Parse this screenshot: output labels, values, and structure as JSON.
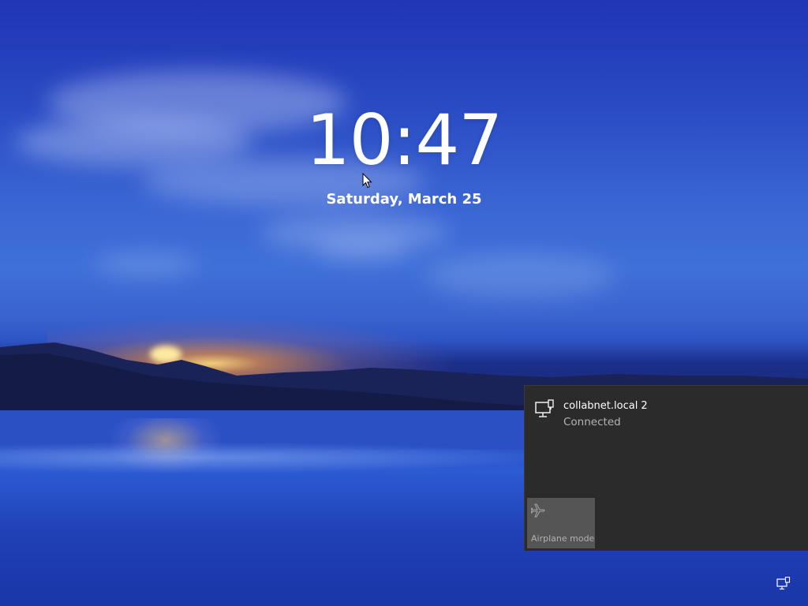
{
  "lock_screen": {
    "time": "10:47",
    "date": "Saturday, March 25"
  },
  "network_flyout": {
    "network_name": "collabnet.local 2",
    "network_status": "Connected",
    "network_icon": "wired-network-icon",
    "airplane_mode": {
      "label": "Airplane mode",
      "icon": "airplane-icon",
      "enabled": false
    }
  },
  "tray": {
    "network_icon": "network-icon"
  },
  "colors": {
    "flyout_bg": "#2b2b2b",
    "tile_bg": "#555555",
    "secondary_text": "#b4b4b4"
  }
}
